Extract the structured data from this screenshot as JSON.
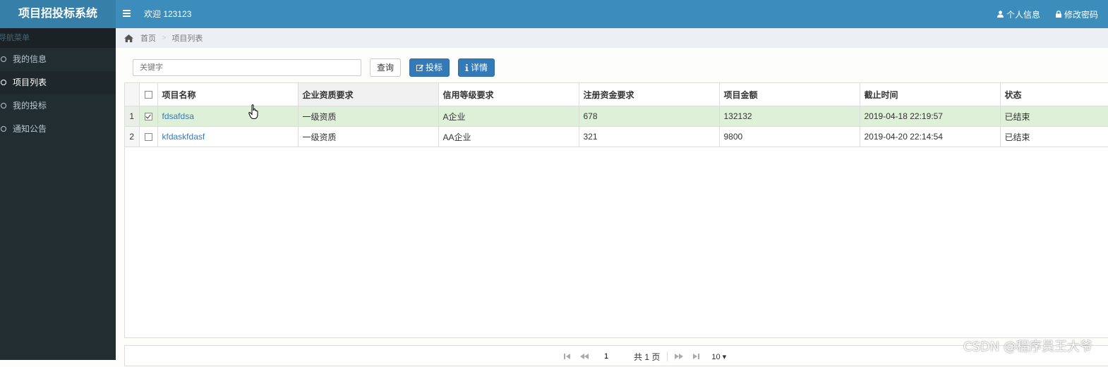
{
  "app": {
    "title": "项目招投标系统",
    "welcome": "欢迎 123123",
    "nav_right": {
      "profile": "个人信息",
      "password": "修改密码"
    }
  },
  "sidebar": {
    "header": "导航菜单",
    "items": [
      {
        "label": "我的信息"
      },
      {
        "label": "项目列表"
      },
      {
        "label": "我的投标"
      },
      {
        "label": "通知公告"
      }
    ],
    "active_index": 1
  },
  "breadcrumb": {
    "home": "首页",
    "current": "项目列表"
  },
  "toolbar": {
    "search_placeholder": "关键字",
    "search_label": "查询",
    "bid_label": "投标",
    "detail_label": "详情"
  },
  "table": {
    "columns": [
      "项目名称",
      "企业资质要求",
      "信用等级要求",
      "注册资金要求",
      "项目金额",
      "截止时间",
      "状态"
    ],
    "rows": [
      {
        "num": "1",
        "checked": true,
        "name": "fdsafdsa",
        "qual": "一级资质",
        "credit": "A企业",
        "capital": "678",
        "amount": "132132",
        "deadline": "2019-04-18 22:19:57",
        "status": "已结束"
      },
      {
        "num": "2",
        "checked": false,
        "name": "kfdaskfdasf",
        "qual": "一级资质",
        "credit": "AA企业",
        "capital": "321",
        "amount": "9800",
        "deadline": "2019-04-20 22:14:54",
        "status": "已结束"
      }
    ]
  },
  "pager": {
    "page": "1",
    "total": "共 1 页",
    "page_size": "10 ▾"
  },
  "watermark": "CSDN @程序员王大爷",
  "colors": {
    "header": "#3c8dbc",
    "logo": "#367fa9",
    "sidebar": "#222d32",
    "primary": "#337ab7",
    "selected_row": "#dff0d8"
  }
}
